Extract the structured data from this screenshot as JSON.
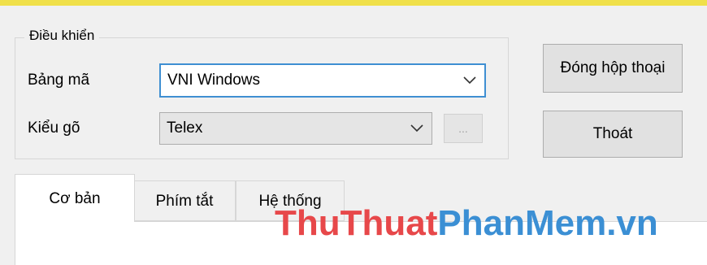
{
  "group": {
    "title": "Điều khiển"
  },
  "encoding": {
    "label": "Bảng mã",
    "value": "VNI Windows"
  },
  "input_method": {
    "label": "Kiểu gõ",
    "value": "Telex",
    "more_label": "..."
  },
  "buttons": {
    "close_dialog": "Đóng hộp thoại",
    "exit": "Thoát"
  },
  "tabs": [
    {
      "label": "Cơ bản",
      "active": true
    },
    {
      "label": "Phím tắt",
      "active": false
    },
    {
      "label": "Hệ thống",
      "active": false
    }
  ],
  "watermark": {
    "part1": "ThuThuat",
    "part2": "PhanMem.vn"
  },
  "colors": {
    "accent_bar": "#f0e04a",
    "focus": "#3f8fd2",
    "watermark_red": "#e7484a",
    "watermark_blue": "#3b8fd4"
  }
}
